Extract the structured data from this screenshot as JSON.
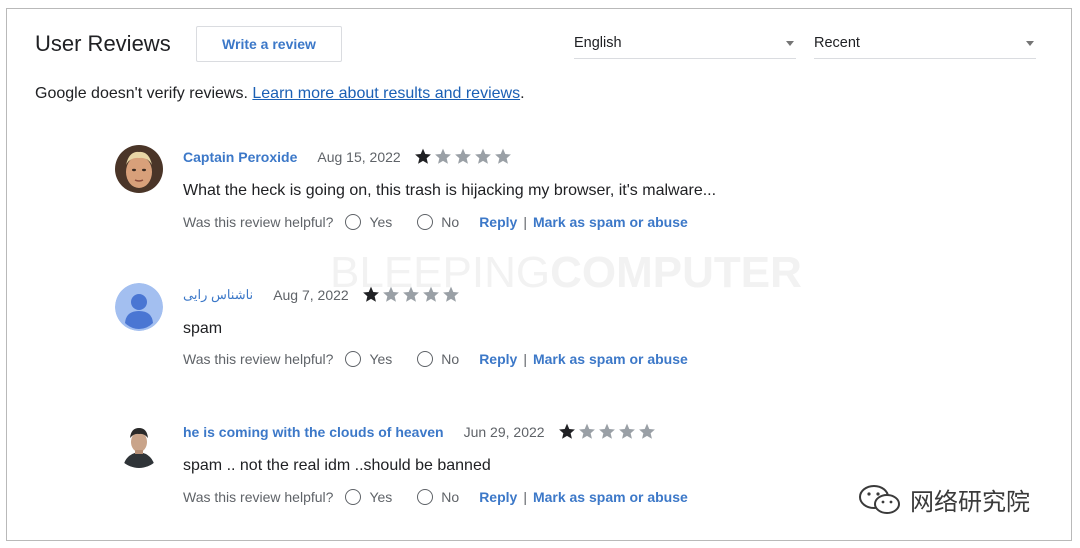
{
  "header": {
    "title": "User Reviews",
    "write_review_label": "Write a review",
    "language_value": "English",
    "sort_value": "Recent"
  },
  "notice": {
    "text": "Google doesn't verify reviews. ",
    "link": "Learn more about results and reviews",
    "trailing": "."
  },
  "reviews": [
    {
      "author": "Captain Peroxide",
      "date": "Aug 15, 2022",
      "rating": 1,
      "text": "What the heck is going on, this trash is hijacking my browser, it's malware...",
      "helpful_label": "Was this review helpful?",
      "yes_label": "Yes",
      "no_label": "No",
      "reply_label": "Reply",
      "spam_label": "Mark as spam or abuse",
      "separator": "|"
    },
    {
      "author": "ناشناس رایی",
      "date": "Aug 7, 2022",
      "rating": 1,
      "text": "spam",
      "helpful_label": "Was this review helpful?",
      "yes_label": "Yes",
      "no_label": "No",
      "reply_label": "Reply",
      "spam_label": "Mark as spam or abuse",
      "separator": "|"
    },
    {
      "author": "he is coming with the clouds of heaven",
      "date": "Jun 29, 2022",
      "rating": 1,
      "text": "spam .. not the real idm ..should be banned",
      "helpful_label": "Was this review helpful?",
      "yes_label": "Yes",
      "no_label": "No",
      "reply_label": "Reply",
      "spam_label": "Mark as spam or abuse",
      "separator": "|"
    }
  ],
  "watermark": {
    "light": "BLEEPING",
    "bold": "COMPUTER"
  },
  "corner_label": "网络研究院",
  "icons": [
    "star-filled-icon",
    "star-empty-icon",
    "radio-icon",
    "caret-down-icon",
    "default-avatar-icon",
    "wechat-icon"
  ],
  "colors": {
    "link": "#3c78c8",
    "star_filled": "#202124",
    "star_empty": "#9aa0a6"
  }
}
